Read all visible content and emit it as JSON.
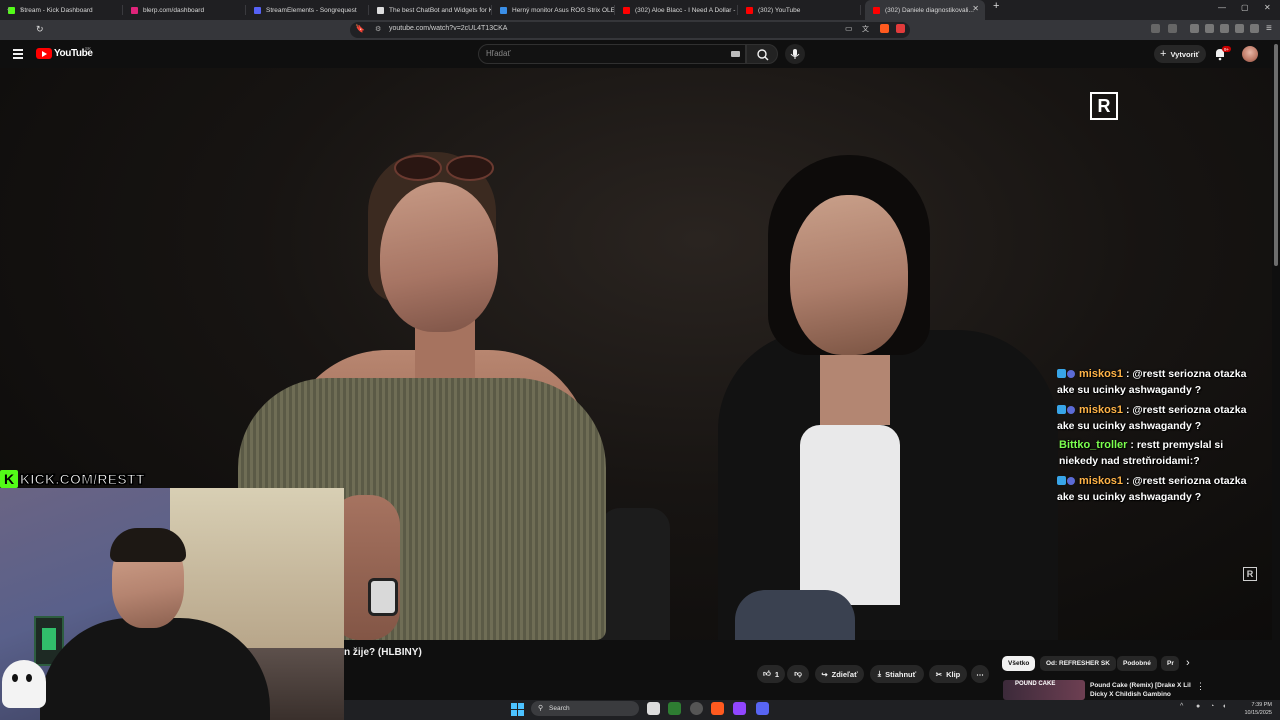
{
  "browser": {
    "tabs": [
      {
        "title": "Stream - Kick Dashboard",
        "color": "#53fc18"
      },
      {
        "title": "blerp.com/dashboard",
        "color": "#e0247a"
      },
      {
        "title": "StreamElements - Songrequest",
        "color": "#5662f6"
      },
      {
        "title": "The best ChatBot and Widgets for K...",
        "color": "#dddddd"
      },
      {
        "title": "Herný monitor Asus ROG Strix OLED...",
        "color": "#3a8ee6"
      },
      {
        "title": "(302) Aloe Blacc - I Need A Dollar - Y...",
        "color": "#ff0000"
      },
      {
        "title": "(302) YouTube",
        "color": "#ff0000"
      }
    ],
    "active_tab": {
      "title": "(302) Daniele diagnostikovali...",
      "color": "#ff0000"
    },
    "url": "youtube.com/watch?v=2cUL4T13CKA"
  },
  "youtube": {
    "logo_text": "YouTube",
    "country": "SK",
    "search_placeholder": "Hľadať",
    "create_label": "Vytvoriť",
    "notification_badge": "9+"
  },
  "video": {
    "title": "n žije? (HLBINY)",
    "channel_logo": "R"
  },
  "chat": [
    {
      "user": "miskos1",
      "color": "#ffb347",
      "text": "@restt seriozna otazka ake su ucinky ashwagandy ?",
      "badges": true
    },
    {
      "user": "miskos1",
      "color": "#ffb347",
      "text": "@restt seriozna otazka ake su ucinky ashwagandy ?",
      "badges": true
    },
    {
      "user": "Bittko_troller",
      "color": "#7cff4f",
      "text": "restt premyslal si niekedy nad stretňroidami:?",
      "badges": false
    },
    {
      "user": "miskos1",
      "color": "#ffb347",
      "text": "@restt seriozna otazka ake su ucinky ashwagandy ?",
      "badges": true
    }
  ],
  "overlay": {
    "kick_label": "KICK.COM/RESTT",
    "kick_logo": "K"
  },
  "actions": {
    "likes": "1",
    "share": "Zdieľať",
    "download": "Stiahnuť",
    "clip": "Klip"
  },
  "chips": [
    "Všetko",
    "Od: REFRESHER SK",
    "Podobné",
    "Pr"
  ],
  "recommendation": {
    "title": "Pound Cake (Remix) [Drake X Lil Dicky X Childish Gambino",
    "thumb_text": "POUND CAKE"
  },
  "taskbar": {
    "search": "Search",
    "time": "7:39 PM",
    "date": "10/15/2025"
  }
}
